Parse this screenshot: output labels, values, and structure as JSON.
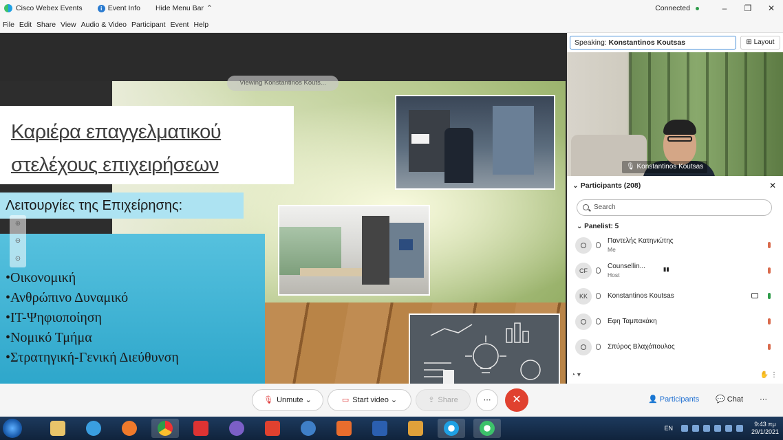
{
  "titlebar": {
    "app_name": "Cisco Webex Events",
    "event_info": "Event Info",
    "hide_menu": "Hide Menu Bar",
    "status": "Connected"
  },
  "menu": [
    "File",
    "Edit",
    "Share",
    "View",
    "Audio & Video",
    "Participant",
    "Event",
    "Help"
  ],
  "share": {
    "viewing_label": "Viewing Konstantinos Kouts...",
    "slide": {
      "title_line1": "Καριέρα επαγγελματικού",
      "title_line2": "στελέχους επιχειρήσεων",
      "subtitle": "Λειτουργίες της Επιχείρησης:",
      "bullets": [
        "•Οικονομική",
        "•Ανθρώπινο Δυναμικό",
        "•IT-Ψηφιοποίηση",
        "•Νομικό Τμήμα",
        "•Στρατηγική-Γενική Διεύθυνση"
      ]
    }
  },
  "panel": {
    "speaking_label": "Speaking:",
    "speaking_name": "Konstantinos Koutsas",
    "layout_label": "Layout",
    "video_name": "Konstantinos Koutsas",
    "participants_title": "Participants (208)",
    "search_placeholder": "Search",
    "panelist_header": "Panelist: 5",
    "panelists": [
      {
        "initials": "",
        "name": "Παντελής Κατηνιώτης",
        "sub": "Me"
      },
      {
        "initials": "CF",
        "name": "Counsellin...",
        "sub": "Host"
      },
      {
        "initials": "KK",
        "name": "Konstantinos Koutsas",
        "sub": ""
      },
      {
        "initials": "",
        "name": "Εφη Ταμπακάκη",
        "sub": ""
      },
      {
        "initials": "",
        "name": "Σπύρος Βλαχόπουλος",
        "sub": ""
      }
    ]
  },
  "controls": {
    "unmute": "Unmute",
    "start_video": "Start video",
    "share": "Share",
    "participants": "Participants",
    "chat": "Chat"
  },
  "taskbar": {
    "lang": "EN",
    "time": "9:43 πμ",
    "date": "29/1/2021"
  }
}
